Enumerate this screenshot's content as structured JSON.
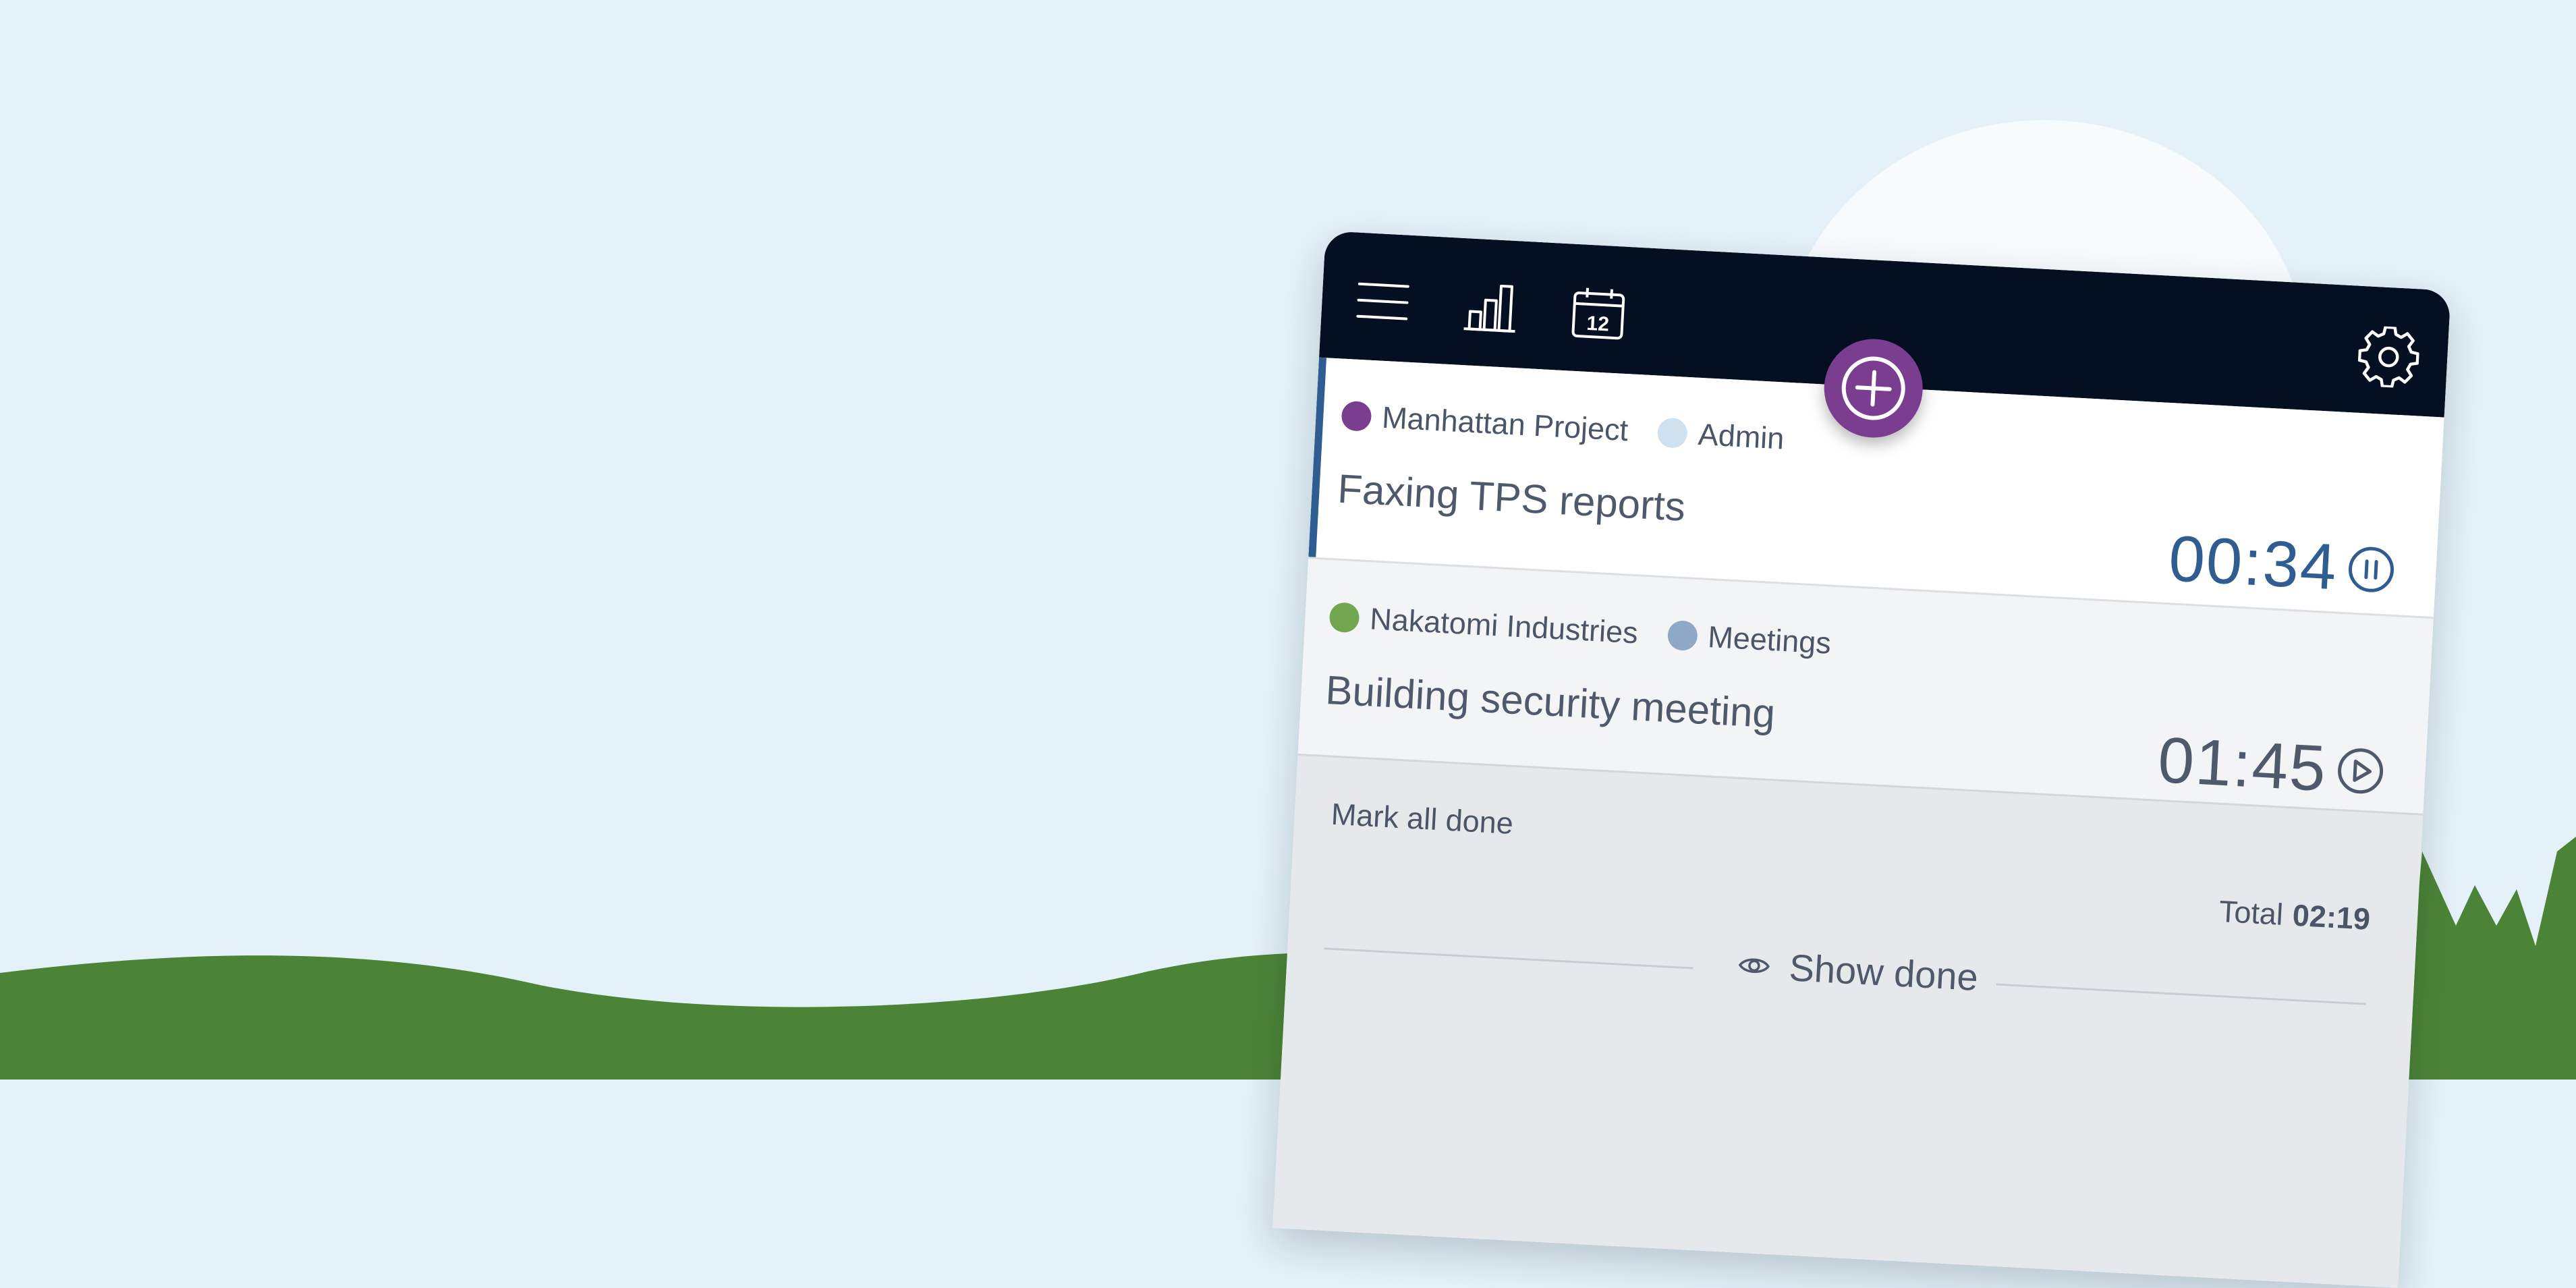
{
  "scene": {
    "colors": {
      "sky": "#e4f1f9",
      "sun": "#f7fbfd",
      "grass": "#4c8437"
    }
  },
  "topbar": {
    "color": "#050f22",
    "icons": [
      "menu-icon",
      "bar-chart-icon",
      "calendar-icon",
      "gear-icon"
    ],
    "calendar_day": "12"
  },
  "add_button": {
    "icon": "plus-circle-icon",
    "color": "#7a3d90"
  },
  "entries": [
    {
      "client": "Manhattan Project",
      "client_color": "#7a3d90",
      "category": "Admin",
      "category_color": "#cfe0ee",
      "title": "Faxing TPS reports",
      "time": "00:34",
      "state": "running",
      "control_icon": "pause-icon",
      "accent_color": "#2f5c91"
    },
    {
      "client": "Nakatomi Industries",
      "client_color": "#72a750",
      "category": "Meetings",
      "category_color": "#8fa8c6",
      "title": "Building security meeting",
      "time": "01:45",
      "state": "paused",
      "control_icon": "play-icon"
    }
  ],
  "footer": {
    "mark_all_done": "Mark all done",
    "total_label": "Total",
    "total_value": "02:19",
    "show_done": "Show done",
    "show_done_icon": "eye-icon"
  }
}
